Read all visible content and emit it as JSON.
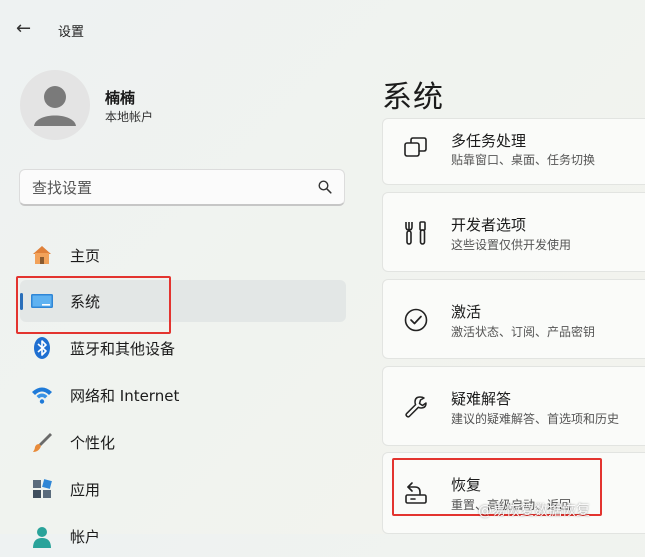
{
  "window": {
    "title": "设置",
    "back_icon": "arrow-left-icon"
  },
  "user": {
    "name": "楠楠",
    "account_type": "本地帐户",
    "avatar_icon": "user-avatar-icon"
  },
  "search": {
    "placeholder": "查找设置",
    "icon": "search-icon"
  },
  "nav": {
    "items": [
      {
        "label": "主页",
        "icon": "home-icon",
        "active": false
      },
      {
        "label": "系统",
        "icon": "system-icon",
        "active": true
      },
      {
        "label": "蓝牙和其他设备",
        "icon": "bluetooth-icon",
        "active": false
      },
      {
        "label": "网络和 Internet",
        "icon": "wifi-icon",
        "active": false
      },
      {
        "label": "个性化",
        "icon": "brush-icon",
        "active": false
      },
      {
        "label": "应用",
        "icon": "apps-icon",
        "active": false
      },
      {
        "label": "帐户",
        "icon": "account-icon",
        "active": false
      }
    ]
  },
  "main": {
    "title": "系统",
    "cards": [
      {
        "title": "多任务处理",
        "subtitle": "贴靠窗口、桌面、任务切换",
        "icon": "multitasking-icon"
      },
      {
        "title": "开发者选项",
        "subtitle": "这些设置仅供开发使用",
        "icon": "developer-tools-icon"
      },
      {
        "title": "激活",
        "subtitle": "激活状态、订阅、产品密钥",
        "icon": "activation-check-icon"
      },
      {
        "title": "疑难解答",
        "subtitle": "建议的疑难解答、首选项和历史",
        "icon": "troubleshoot-wrench-icon"
      },
      {
        "title": "恢复",
        "subtitle": "重置、高级启动、返回",
        "icon": "recovery-icon"
      }
    ]
  },
  "watermark": {
    "text": "@易恢复数据恢复"
  },
  "colors": {
    "accent": "#2a6fba",
    "highlight_box": "#e3342f"
  }
}
